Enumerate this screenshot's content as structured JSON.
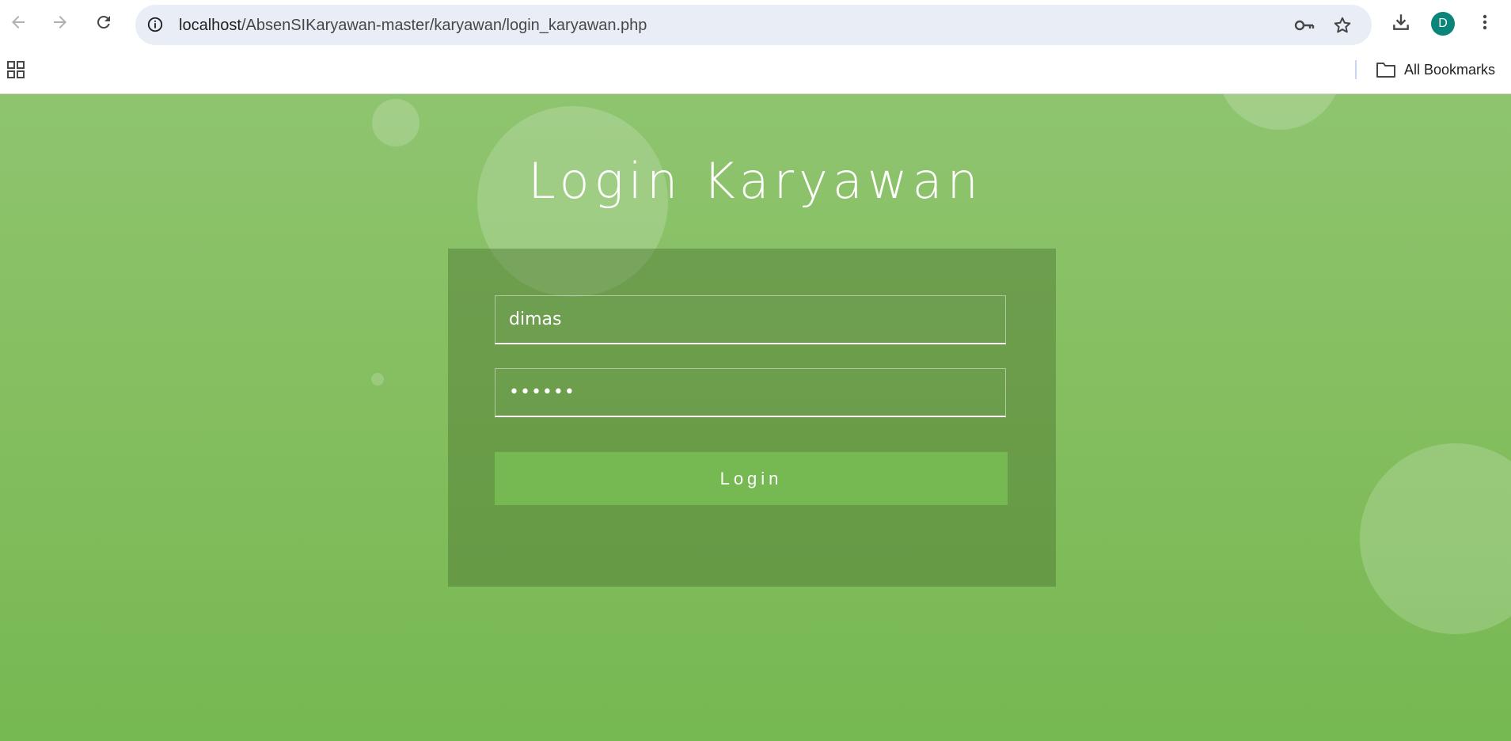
{
  "browser": {
    "url_host": "localhost",
    "url_path": "/AbsenSIKaryawan-master/karyawan/login_karyawan.php",
    "profile_initial": "D",
    "bookmarks_label": "All Bookmarks"
  },
  "login": {
    "title": "Login Karyawan",
    "username_value": "dimas",
    "password_mask": "••••••",
    "submit_label": "Login"
  },
  "colors": {
    "accent": "#76b852",
    "background_top": "#8ec46f",
    "avatar": "#0b8579"
  }
}
